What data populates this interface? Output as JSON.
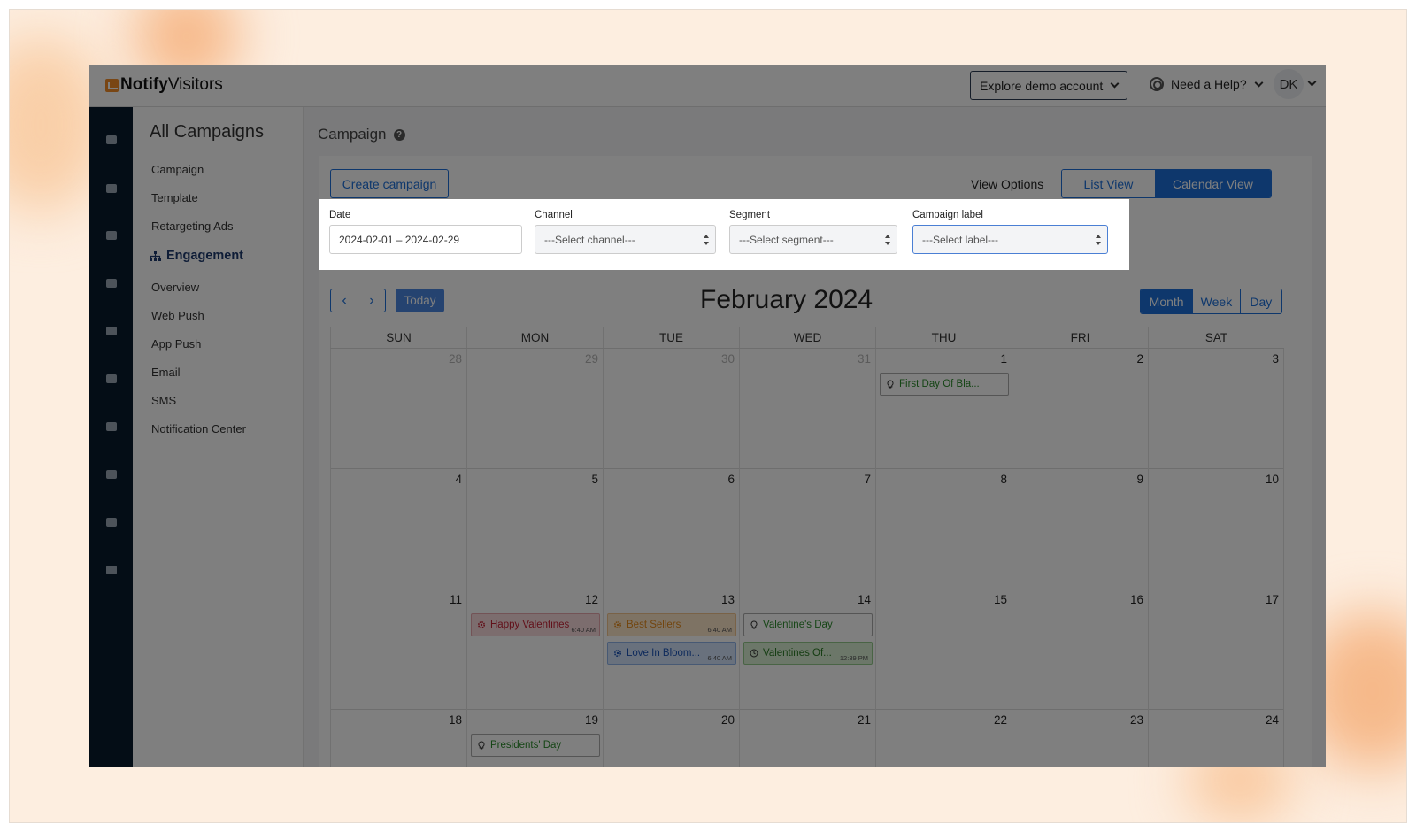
{
  "header": {
    "logo_bold": "Notify",
    "logo_rest": "Visitors",
    "demo_button": "Explore demo account",
    "help": "Need a Help?",
    "avatar": "DK"
  },
  "rail_icons": [
    "apps-icon",
    "dashboard-icon",
    "analytics-icon",
    "users-icon",
    "engagement-icon",
    "send-icon",
    "list-icon",
    "image-icon",
    "settings-icon",
    "document-icon"
  ],
  "sidebar": {
    "title": "All Campaigns",
    "items": [
      "Campaign",
      "Template",
      "Retargeting Ads"
    ],
    "section": "Engagement",
    "sub_items": [
      "Overview",
      "Web Push",
      "App Push",
      "Email",
      "SMS",
      "Notification Center"
    ]
  },
  "main": {
    "title": "Campaign",
    "create_button": "Create campaign",
    "view_options": "View Options",
    "list_view": "List View",
    "calendar_view": "Calendar View"
  },
  "filters": {
    "date_label": "Date",
    "date_value": "2024-02-01 – 2024-02-29",
    "channel_label": "Channel",
    "channel_value": "---Select channel---",
    "segment_label": "Segment",
    "segment_value": "---Select segment---",
    "label_label": "Campaign label",
    "label_value": "---Select label---"
  },
  "calendar": {
    "title": "February 2024",
    "today": "Today",
    "month": "Month",
    "week": "Week",
    "day": "Day",
    "days": [
      "SUN",
      "MON",
      "TUE",
      "WED",
      "THU",
      "FRI",
      "SAT"
    ],
    "weeks": [
      [
        {
          "n": "28",
          "o": true
        },
        {
          "n": "29",
          "o": true
        },
        {
          "n": "30",
          "o": true
        },
        {
          "n": "31",
          "o": true
        },
        {
          "n": "1"
        },
        {
          "n": "2"
        },
        {
          "n": "3"
        }
      ],
      [
        {
          "n": "4"
        },
        {
          "n": "5"
        },
        {
          "n": "6"
        },
        {
          "n": "7"
        },
        {
          "n": "8"
        },
        {
          "n": "9"
        },
        {
          "n": "10"
        }
      ],
      [
        {
          "n": "11"
        },
        {
          "n": "12"
        },
        {
          "n": "13"
        },
        {
          "n": "14"
        },
        {
          "n": "15"
        },
        {
          "n": "16"
        },
        {
          "n": "17"
        }
      ],
      [
        {
          "n": "18"
        },
        {
          "n": "19"
        },
        {
          "n": "20"
        },
        {
          "n": "21"
        },
        {
          "n": "22"
        },
        {
          "n": "23"
        },
        {
          "n": "24"
        }
      ]
    ],
    "events": [
      {
        "week": 0,
        "day": 4,
        "slot": 0,
        "title": "First Day Of Bla...",
        "style": "white",
        "icon": "bulb-icon",
        "time": ""
      },
      {
        "week": 2,
        "day": 1,
        "slot": 0,
        "title": "Happy Valentines",
        "style": "red",
        "icon": "gear-icon",
        "time": "6:40 AM"
      },
      {
        "week": 2,
        "day": 2,
        "slot": 0,
        "title": "Best Sellers",
        "style": "orange",
        "icon": "gear-icon",
        "time": "6:40 AM"
      },
      {
        "week": 2,
        "day": 2,
        "slot": 1,
        "title": "Love In Bloom...",
        "style": "blue",
        "icon": "gear-icon",
        "time": "6:40 AM"
      },
      {
        "week": 2,
        "day": 3,
        "slot": 0,
        "title": "Valentine's Day",
        "style": "white",
        "icon": "bulb-icon",
        "time": ""
      },
      {
        "week": 2,
        "day": 3,
        "slot": 1,
        "title": "Valentines Of...",
        "style": "green",
        "icon": "clock-icon",
        "time": "12:39 PM"
      },
      {
        "week": 3,
        "day": 1,
        "slot": 0,
        "title": "Presidents' Day",
        "style": "white",
        "icon": "bulb-icon",
        "time": ""
      }
    ]
  }
}
